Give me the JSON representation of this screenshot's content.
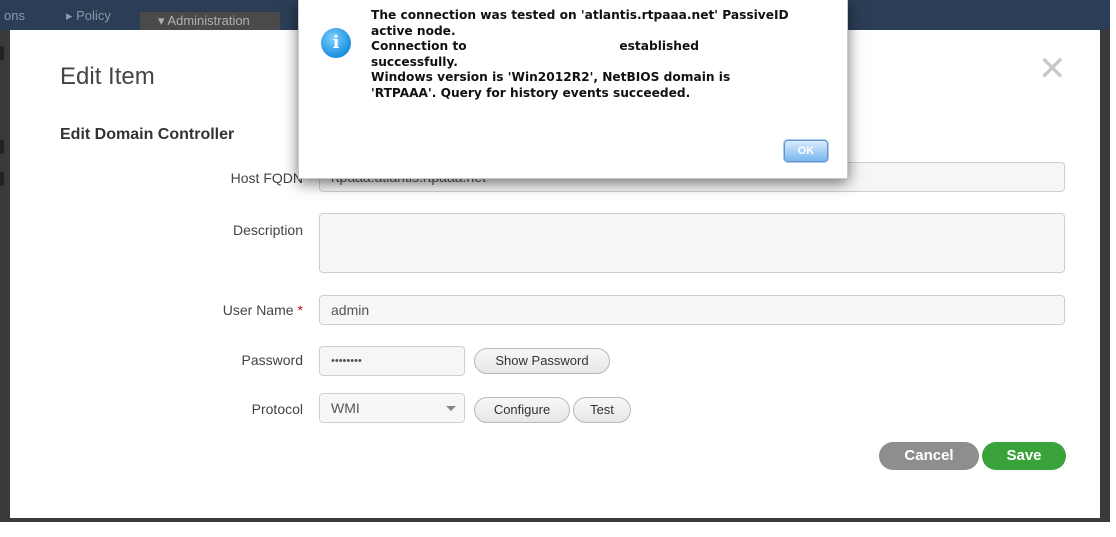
{
  "nav": {
    "item_partial": "ons",
    "item_policy": "▸ Policy",
    "item_admin": "▾ Administration"
  },
  "modal": {
    "title": "Edit Item",
    "close_icon": "close-icon",
    "section_title": "Edit Domain Controller",
    "fields": {
      "host_fqdn_label": "Host FQDN",
      "host_fqdn_value": "rtpaaa.atlantis.rtpaaa.net",
      "description_label": "Description",
      "description_value": "",
      "username_label": "User Name",
      "username_required": "*",
      "username_value": "admin",
      "password_label": "Password",
      "password_value": "••••••••",
      "show_password_label": "Show Password",
      "protocol_label": "Protocol",
      "protocol_value": "WMI",
      "configure_label": "Configure",
      "test_label": "Test"
    },
    "cancel_label": "Cancel",
    "save_label": "Save"
  },
  "alert": {
    "icon": "info-icon",
    "lines": [
      "The connection was tested on 'atlantis.rtpaaa.net' PassiveID",
      "active node.",
      "Connection to                                    established",
      "successfully.",
      "Windows version is 'Win2012R2', NetBIOS domain is",
      "'RTPAAA'. Query for history events succeeded."
    ],
    "ok_label": "OK"
  },
  "colors": {
    "save_green": "#3aa23a",
    "cancel_gray": "#8e8e8e",
    "nav_bg": "#2b3e56",
    "required_red": "#d0021b"
  }
}
